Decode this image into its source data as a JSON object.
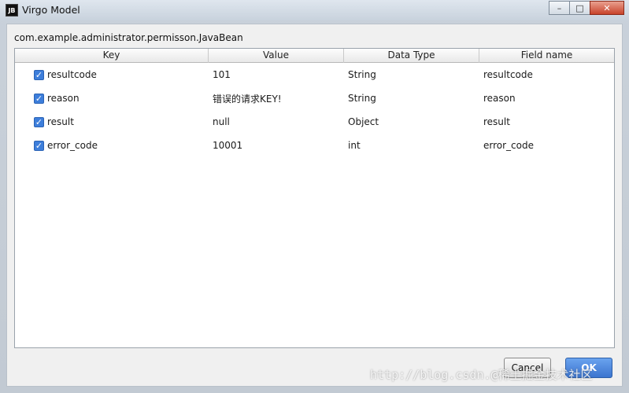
{
  "window": {
    "title": "Virgo Model",
    "icon_text": "JB"
  },
  "titlebar_buttons": {
    "minimize": "–",
    "maximize": "□",
    "close": "✕"
  },
  "class_name": "com.example.administrator.permisson.JavaBean",
  "table": {
    "headers": [
      "Key",
      "Value",
      "Data Type",
      "Field name"
    ],
    "rows": [
      {
        "checked": true,
        "key": "resultcode",
        "value": "101",
        "type": "String",
        "field": "resultcode"
      },
      {
        "checked": true,
        "key": "reason",
        "value": "错误的请求KEY!",
        "type": "String",
        "field": "reason"
      },
      {
        "checked": true,
        "key": "result",
        "value": "null",
        "type": "Object",
        "field": "result"
      },
      {
        "checked": true,
        "key": "error_code",
        "value": "10001",
        "type": "int",
        "field": "error_code"
      }
    ]
  },
  "buttons": {
    "cancel": "Cancel",
    "ok": "OK"
  },
  "watermark": "http://blog.csdn.@稀土掘金技术社区",
  "colors": {
    "checkbox": "#3d7edb",
    "ok_button": "#3b74cf",
    "close_button": "#c8432b"
  }
}
